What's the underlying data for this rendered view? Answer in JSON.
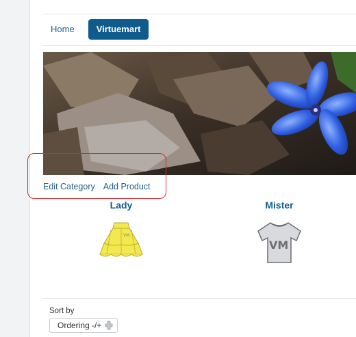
{
  "nav": {
    "home": "Home",
    "virtuemart": "Virtuemart"
  },
  "category_actions": {
    "edit_category": "Edit Category",
    "add_product": "Add Product"
  },
  "categories": [
    {
      "title": "Lady",
      "icon": "skirt-icon",
      "color": "#f2e94e"
    },
    {
      "title": "Mister",
      "icon": "tshirt-icon",
      "color": "#d8dadd"
    }
  ],
  "sort": {
    "label": "Sort by",
    "selected": "Ordering -/+"
  },
  "colors": {
    "accent": "#0f5c8c",
    "annotation": "#d9262f"
  }
}
